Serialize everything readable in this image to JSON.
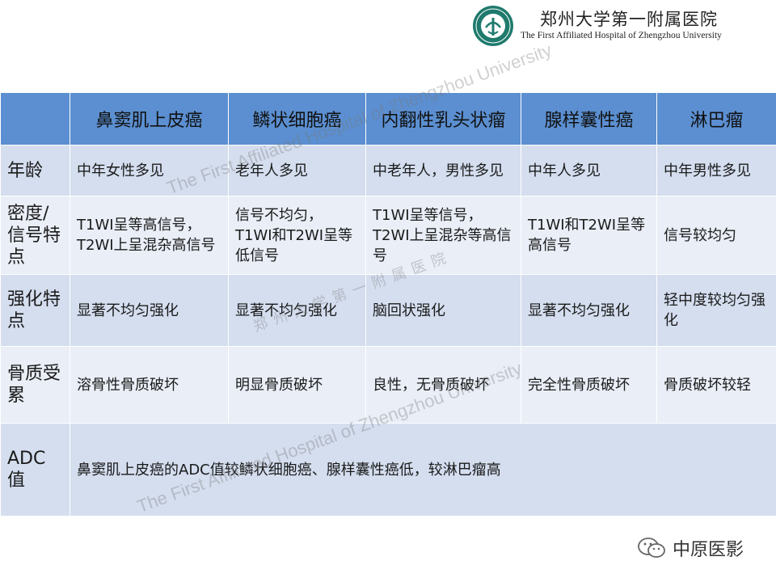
{
  "header": {
    "hospital_cn": "郑州大学第一附属医院",
    "hospital_en": "The First Affiliated Hospital of Zhengzhou University"
  },
  "watermark": {
    "text_en": "The First Affiliated Hospital of Zhengzhou University",
    "text_cn": "郑州大学第一附属医院"
  },
  "table": {
    "columns": [
      "",
      "鼻窦肌上皮癌",
      "鳞状细胞癌",
      "内翻性乳头状瘤",
      "腺样囊性癌",
      "淋巴瘤"
    ],
    "rows": [
      {
        "label": "年龄",
        "cells": [
          "中年女性多见",
          "老年人多见",
          "中老年人，男性多见",
          "中年人多见",
          "中年男性多见"
        ]
      },
      {
        "label": "密度/信号特点",
        "cells": [
          "T1WI呈等高信号，T2WI上呈混杂高信号",
          "信号不均匀，T1WI和T2WI呈等低信号",
          "T1WI呈等信号，T2WI上呈混杂等高信号",
          "T1WI和T2WI呈等高信号",
          "信号较均匀"
        ]
      },
      {
        "label": "强化特点",
        "cells": [
          "显著不均匀强化",
          "显著不均匀强化",
          "脑回状强化",
          "显著不均匀强化",
          "轻中度较均匀强化"
        ]
      },
      {
        "label": "骨质受累",
        "cells": [
          "溶骨性骨质破坏",
          "明显骨质破坏",
          "良性，无骨质破坏",
          "完全性骨质破坏",
          "骨质破坏较轻"
        ]
      },
      {
        "label": "ADC值",
        "merged": "鼻窦肌上皮癌的ADC值较鳞状细胞癌、腺样囊性癌低，较淋巴瘤高"
      }
    ]
  },
  "footer": {
    "brand": "中原医影",
    "icon": "wechat-icon"
  },
  "colors": {
    "header_row": "#5b8fd1",
    "row_odd": "#d4deef",
    "row_even": "#e9eef7",
    "logo_green": "#1f7a6d"
  }
}
